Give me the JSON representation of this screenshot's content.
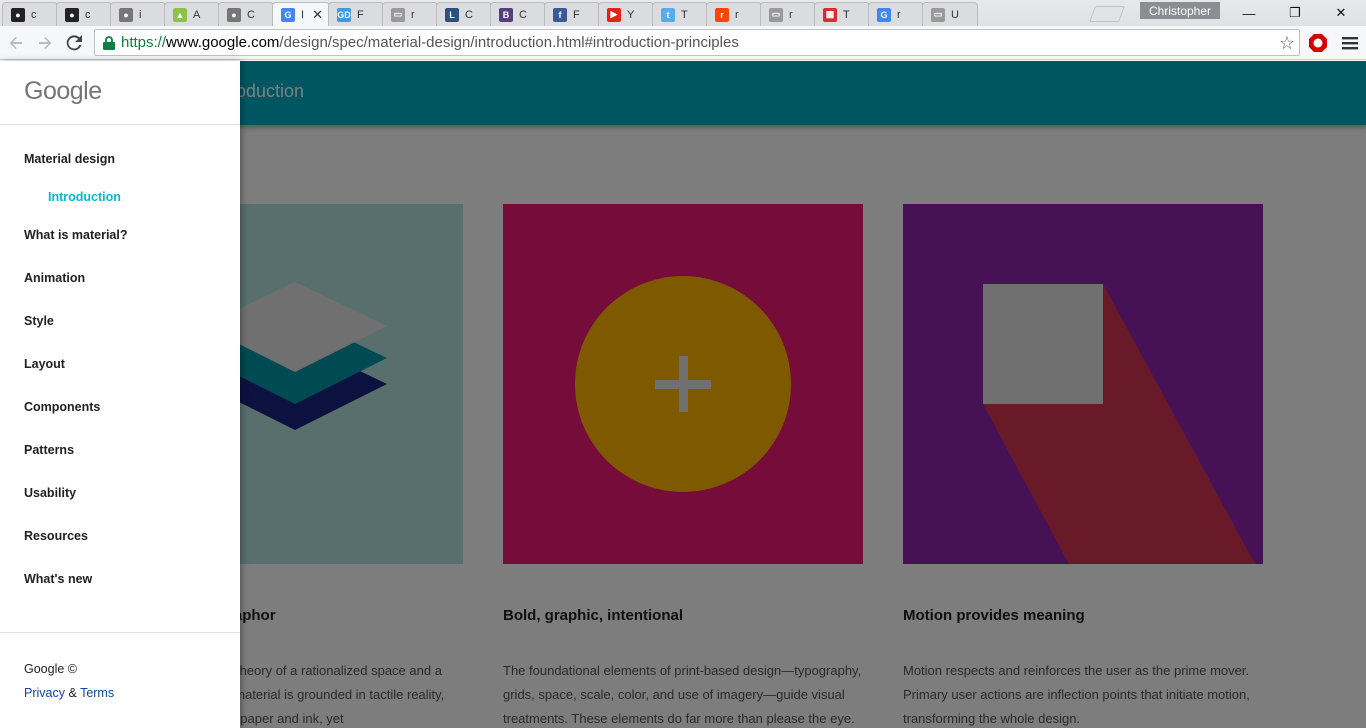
{
  "browser": {
    "tabs": [
      {
        "title": "c",
        "icon": "github-icon",
        "color": "#222222"
      },
      {
        "title": "c",
        "icon": "github-icon",
        "color": "#222222"
      },
      {
        "title": "i",
        "icon": "apple-icon",
        "color": "#777777"
      },
      {
        "title": "A",
        "icon": "android-icon",
        "color": "#8bc34a"
      },
      {
        "title": "C",
        "icon": "apple-icon",
        "color": "#777777"
      },
      {
        "title": "I",
        "icon": "google-icon",
        "color": "#4285f4",
        "active": true
      },
      {
        "title": "F",
        "icon": "gd-icon",
        "color": "#3b9ae1"
      },
      {
        "title": "r",
        "icon": "page-icon",
        "color": "#999999"
      },
      {
        "title": "C",
        "icon": "lmu-icon",
        "color": "#2d4f7c"
      },
      {
        "title": "C",
        "icon": "bootstrap-icon",
        "color": "#563d7c"
      },
      {
        "title": "F",
        "icon": "facebook-icon",
        "color": "#3b5998"
      },
      {
        "title": "Y",
        "icon": "youtube-icon",
        "color": "#e62117"
      },
      {
        "title": "T",
        "icon": "twitter-icon",
        "color": "#55acee"
      },
      {
        "title": "r",
        "icon": "reddit-icon",
        "color": "#ff4500"
      },
      {
        "title": "r",
        "icon": "page-icon",
        "color": "#999999"
      },
      {
        "title": "T",
        "icon": "chart-icon",
        "color": "#d32f2f"
      },
      {
        "title": "r",
        "icon": "google-icon",
        "color": "#4285f4"
      },
      {
        "title": "U",
        "icon": "page-icon",
        "color": "#999999"
      }
    ],
    "active_tab_close": "✕",
    "profile_name": "Christopher",
    "window_buttons": {
      "minimize": "—",
      "restore": "❐",
      "close": "✕"
    },
    "url": {
      "scheme": "https://",
      "host": "www.google.com",
      "path": "/design/spec/material-design/introduction.html#introduction-principles"
    }
  },
  "page": {
    "appbar_title": "Introduction",
    "cards": [
      {
        "title": "Material is the metaphor",
        "text": "Material is the unifying theory of a rationalized space and a system of motion. The material is grounded in tactile reality, inspired by the study of paper and ink, yet"
      },
      {
        "title": "Bold, graphic, intentional",
        "text": "The foundational elements of print-based design—typography, grids, space, scale, color, and use of imagery—guide visual treatments. These elements do far more than please the eye."
      },
      {
        "title": "Motion provides meaning",
        "text": "Motion respects and reinforces the user as the prime mover. Primary user actions are inflection points that initiate motion, transforming the whole design."
      }
    ],
    "colors": {
      "appbar": "#00acc1",
      "card1": "#b2dfdb",
      "card2": "#ec1873",
      "card3": "#8e24aa",
      "fab": "#ffb300",
      "sub_item": "#00bcd4"
    }
  },
  "drawer": {
    "logo": "Google",
    "items": [
      {
        "label": "Material design"
      },
      {
        "label": "Introduction",
        "sub": true
      },
      {
        "label": "What is material?"
      },
      {
        "label": "Animation"
      },
      {
        "label": "Style"
      },
      {
        "label": "Layout"
      },
      {
        "label": "Components"
      },
      {
        "label": "Patterns"
      },
      {
        "label": "Usability"
      },
      {
        "label": "Resources"
      },
      {
        "label": "What's new"
      }
    ],
    "copyright": "Google ©",
    "privacy": "Privacy",
    "amp": "&",
    "terms": "Terms"
  }
}
